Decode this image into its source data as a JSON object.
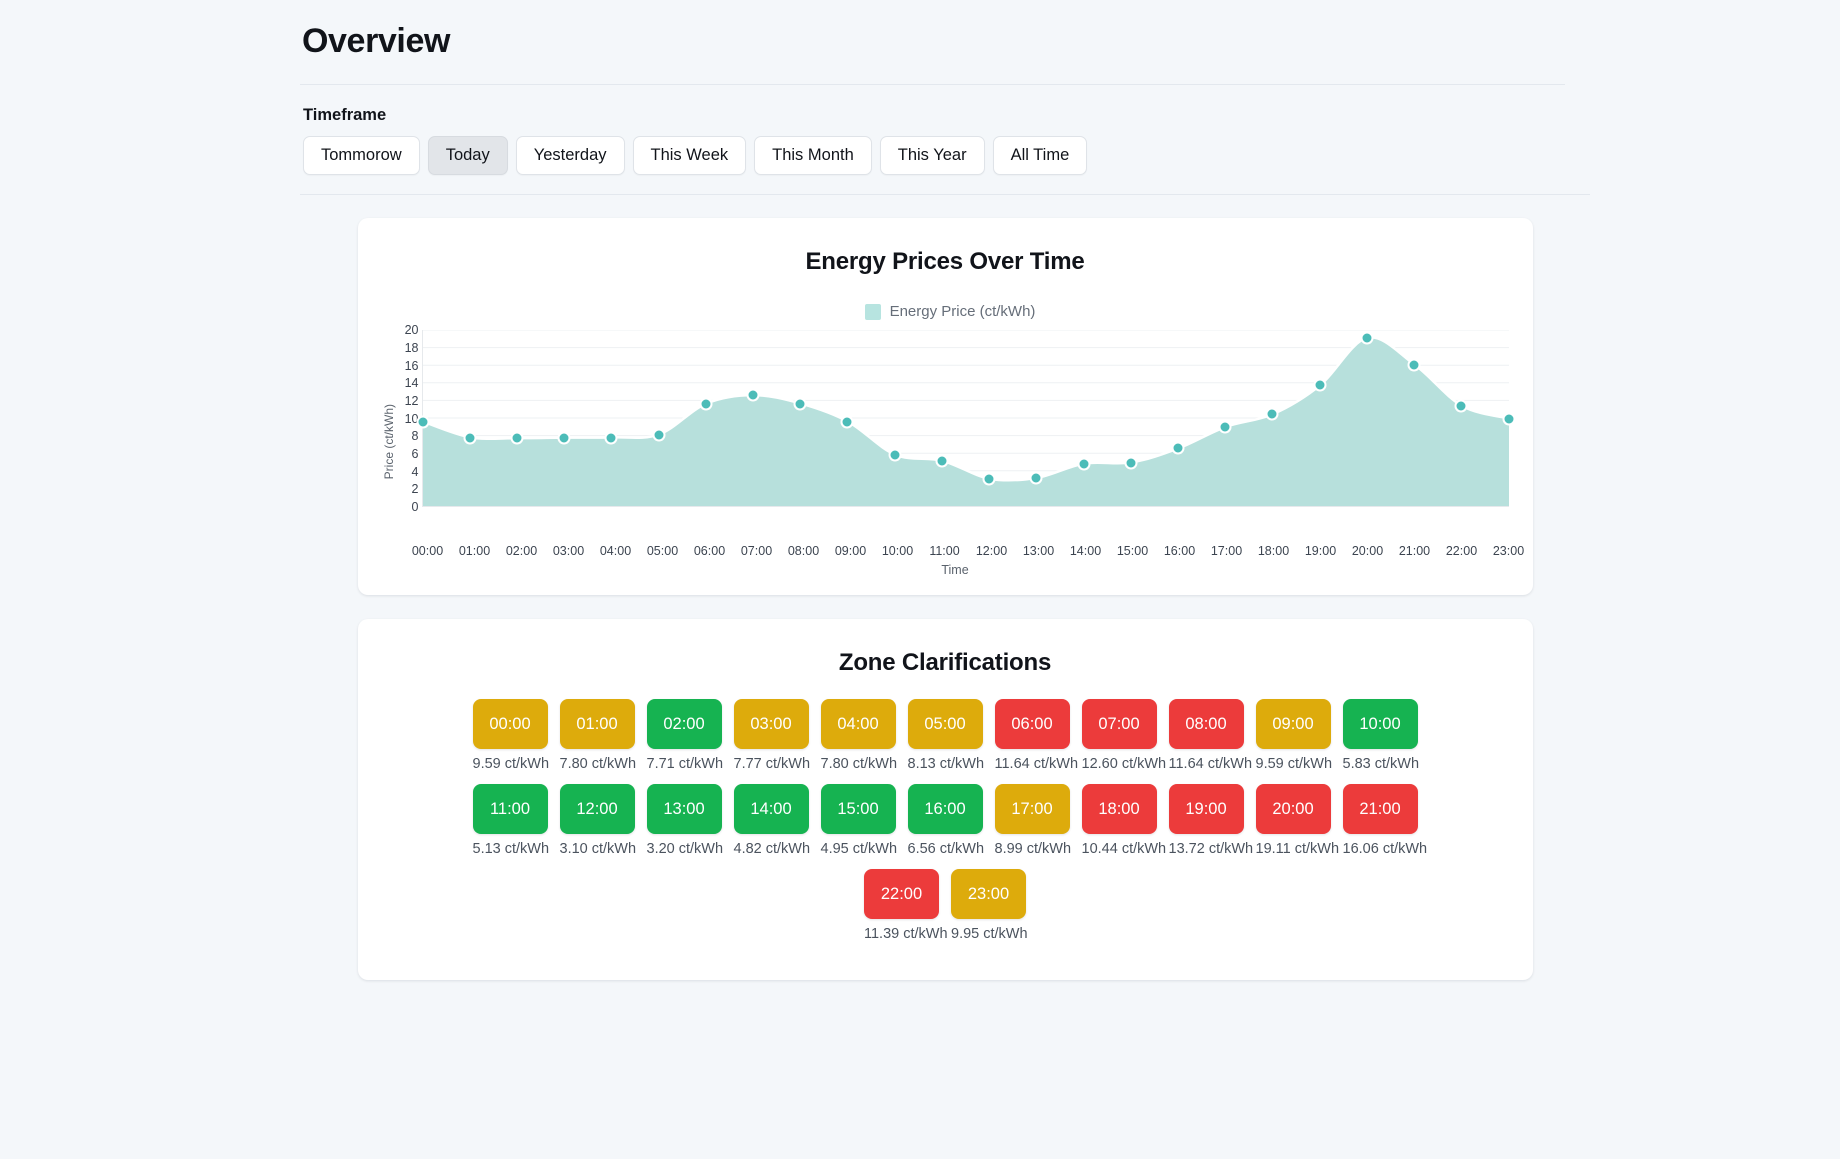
{
  "header": {
    "title": "Overview"
  },
  "timeframe": {
    "label": "Timeframe",
    "active": "Today",
    "options": [
      "Tommorow",
      "Today",
      "Yesterday",
      "This Week",
      "This Month",
      "This Year",
      "All Time"
    ]
  },
  "chart_card": {
    "title": "Energy Prices Over Time"
  },
  "zones_card": {
    "title": "Zone Clarifications"
  },
  "colors": {
    "page_background": "#f4f7fa",
    "card_background": "#ffffff",
    "series_line": "#ffffff",
    "series_point": "#4cbcb8",
    "series_fill": "#b7e0dc",
    "legend_swatch": "#b7e4e0",
    "zone_green": "#16b351",
    "zone_yellow": "#ddab0c",
    "zone_red": "#ec3b3b",
    "active_button": "#e2e5e9"
  },
  "chart_data": {
    "type": "area",
    "title": "Energy Prices Over Time",
    "xlabel": "Time",
    "ylabel": "Price (ct/kWh)",
    "ylim": [
      0,
      20
    ],
    "yticks": [
      0,
      2,
      4,
      6,
      8,
      10,
      12,
      14,
      16,
      18,
      20
    ],
    "grid": true,
    "legend_position": "top-center",
    "legend": [
      "Energy Price (ct/kWh)"
    ],
    "categories": [
      "00:00",
      "01:00",
      "02:00",
      "03:00",
      "04:00",
      "05:00",
      "06:00",
      "07:00",
      "08:00",
      "09:00",
      "10:00",
      "11:00",
      "12:00",
      "13:00",
      "14:00",
      "15:00",
      "16:00",
      "17:00",
      "18:00",
      "19:00",
      "20:00",
      "21:00",
      "22:00",
      "23:00"
    ],
    "series": [
      {
        "name": "Energy Price (ct/kWh)",
        "values": [
          9.59,
          7.8,
          7.71,
          7.77,
          7.8,
          8.13,
          11.64,
          12.6,
          11.64,
          9.59,
          5.83,
          5.13,
          3.1,
          3.2,
          4.82,
          4.95,
          6.56,
          8.99,
          10.44,
          13.72,
          19.11,
          16.06,
          11.39,
          9.95
        ]
      }
    ]
  },
  "zones": {
    "rows": [
      [
        {
          "time": "00:00",
          "price": "9.59 ct/kWh",
          "level": "yellow"
        },
        {
          "time": "01:00",
          "price": "7.80 ct/kWh",
          "level": "yellow"
        },
        {
          "time": "02:00",
          "price": "7.71 ct/kWh",
          "level": "green"
        },
        {
          "time": "03:00",
          "price": "7.77 ct/kWh",
          "level": "yellow"
        },
        {
          "time": "04:00",
          "price": "7.80 ct/kWh",
          "level": "yellow"
        },
        {
          "time": "05:00",
          "price": "8.13 ct/kWh",
          "level": "yellow"
        },
        {
          "time": "06:00",
          "price": "11.64 ct/kWh",
          "level": "red"
        },
        {
          "time": "07:00",
          "price": "12.60 ct/kWh",
          "level": "red"
        },
        {
          "time": "08:00",
          "price": "11.64 ct/kWh",
          "level": "red"
        },
        {
          "time": "09:00",
          "price": "9.59 ct/kWh",
          "level": "yellow"
        },
        {
          "time": "10:00",
          "price": "5.83 ct/kWh",
          "level": "green"
        }
      ],
      [
        {
          "time": "11:00",
          "price": "5.13 ct/kWh",
          "level": "green"
        },
        {
          "time": "12:00",
          "price": "3.10 ct/kWh",
          "level": "green"
        },
        {
          "time": "13:00",
          "price": "3.20 ct/kWh",
          "level": "green"
        },
        {
          "time": "14:00",
          "price": "4.82 ct/kWh",
          "level": "green"
        },
        {
          "time": "15:00",
          "price": "4.95 ct/kWh",
          "level": "green"
        },
        {
          "time": "16:00",
          "price": "6.56 ct/kWh",
          "level": "green"
        },
        {
          "time": "17:00",
          "price": "8.99 ct/kWh",
          "level": "yellow"
        },
        {
          "time": "18:00",
          "price": "10.44 ct/kWh",
          "level": "red"
        },
        {
          "time": "19:00",
          "price": "13.72 ct/kWh",
          "level": "red"
        },
        {
          "time": "20:00",
          "price": "19.11 ct/kWh",
          "level": "red"
        },
        {
          "time": "21:00",
          "price": "16.06 ct/kWh",
          "level": "red"
        }
      ],
      [
        {
          "time": "22:00",
          "price": "11.39 ct/kWh",
          "level": "red"
        },
        {
          "time": "23:00",
          "price": "9.95 ct/kWh",
          "level": "yellow"
        }
      ]
    ]
  }
}
